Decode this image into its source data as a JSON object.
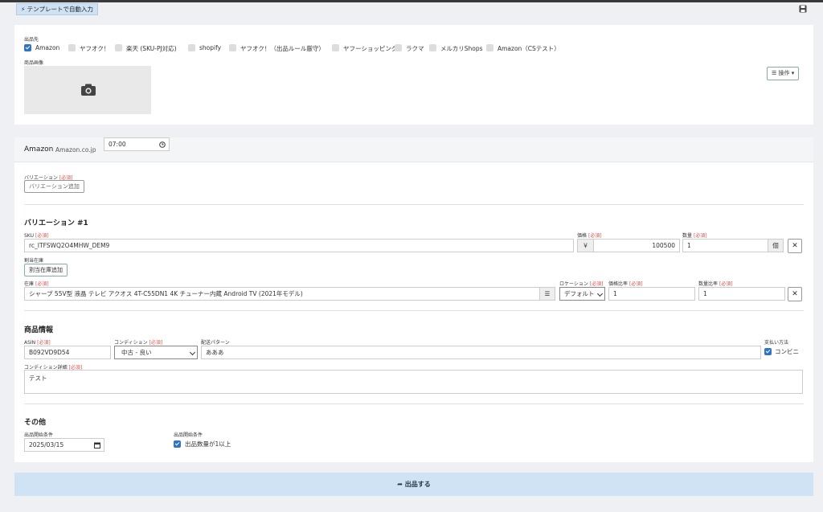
{
  "toolbar": {
    "template_button": "テンプレートで自動入力"
  },
  "listing": {
    "destination_label": "出品先",
    "destinations": [
      {
        "label": "Amazon",
        "checked": true
      },
      {
        "label": "ヤフオク！",
        "checked": false
      },
      {
        "label": "楽天 (SKU-PJ対応)",
        "checked": false
      },
      {
        "label": "shopify",
        "checked": false
      },
      {
        "label": "ヤフオク！（出品ルール厳守）",
        "checked": false
      },
      {
        "label": "ヤフーショッピング",
        "checked": false
      },
      {
        "label": "ラクマ",
        "checked": false
      },
      {
        "label": "メルカリShops",
        "checked": false
      },
      {
        "label": "Amazon（CSテスト）",
        "checked": false
      }
    ],
    "image_label": "商品画像",
    "operations_button": "操作"
  },
  "amazon": {
    "header_title": "Amazon",
    "header_sub": "Amazon.co.jp",
    "req_tag": "[必須]",
    "variation_label": "バリエーション",
    "add_variation_button": "バリエーション追加",
    "variation_title": "バリエーション #1",
    "sku_label": "SKU",
    "sku_value": "rc_ITFSWQ2O4MHW_DEM9",
    "price_label": "価格",
    "currency": "￥",
    "price_value": "100500",
    "qty_label": "数量",
    "qty_value": "1",
    "qty_unit": "個",
    "allocation_label": "割当在庫",
    "add_allocation_button": "割当在庫追加",
    "stock_label": "在庫",
    "stock_value": "シャープ 55V型 液晶 テレビ アクオス 4T-C55DN1 4K チューナー内蔵 Android TV (2021年モデル)",
    "location_label": "ロケーション",
    "location_value": "デフォルト",
    "price_ratio_label": "価格比率",
    "price_ratio_value": "1",
    "qty_ratio_label": "数量比率",
    "qty_ratio_value": "1",
    "product_info_title": "商品情報",
    "asin_label": "ASIN",
    "asin_value": "B092VD9D54",
    "condition_label": "コンディション",
    "condition_value": "中古 - 良い",
    "delivery_label": "配送パターン",
    "delivery_value": "あああ",
    "payment_label": "支払い方法",
    "payment_option": "コンビニ",
    "condition_detail_label": "コンディション詳細",
    "condition_detail_value": "テスト",
    "other_title": "その他",
    "start_label": "出品開始条件",
    "start_date": "2025/03/15",
    "start_time": "07:00",
    "start_condition_label": "出品開始条件",
    "start_condition_option": "出品数量が1以上"
  },
  "submit_button": "出品する",
  "colors": {
    "accent": "#2f74c0",
    "submit_bg": "#cfe3f5",
    "required": "#d9534f"
  }
}
